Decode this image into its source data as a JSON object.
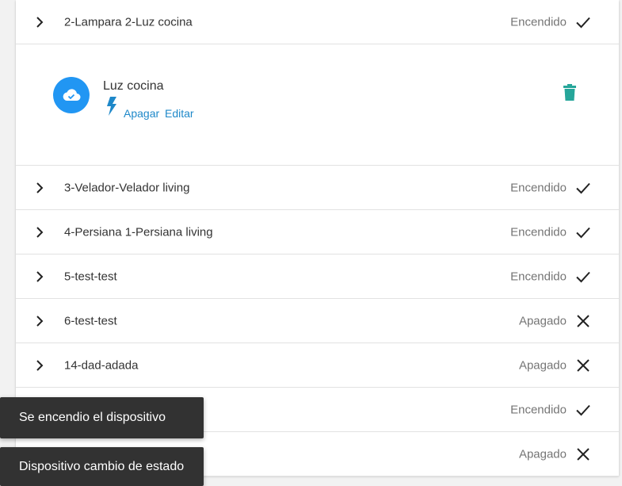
{
  "devices": [
    {
      "label": "2-Lampara 2-Luz cocina",
      "status": "Encendido",
      "state": "on"
    },
    {
      "label": "3-Velador-Velador living",
      "status": "Encendido",
      "state": "on"
    },
    {
      "label": "4-Persiana 1-Persiana living",
      "status": "Encendido",
      "state": "on"
    },
    {
      "label": "5-test-test",
      "status": "Encendido",
      "state": "on"
    },
    {
      "label": "6-test-test",
      "status": "Apagado",
      "state": "off"
    },
    {
      "label": "14-dad-adada",
      "status": "Apagado",
      "state": "off"
    },
    {
      "label": "",
      "status": "Encendido",
      "state": "on"
    },
    {
      "label": "",
      "status": "Apagado",
      "state": "off"
    }
  ],
  "expanded": {
    "name": "Luz cocina",
    "action_label": "Apagar",
    "edit_label": "Editar",
    "avatar_icon": "cloud-check-icon",
    "action_icon": "bolt-icon",
    "delete_icon": "trash-icon",
    "avatar_color": "#2196f3",
    "link_color": "#1e88c9",
    "delete_color": "#26a69a"
  },
  "toasts": [
    {
      "message": "Se encendio el dispositivo"
    },
    {
      "message": "Dispositivo cambio de estado"
    }
  ]
}
